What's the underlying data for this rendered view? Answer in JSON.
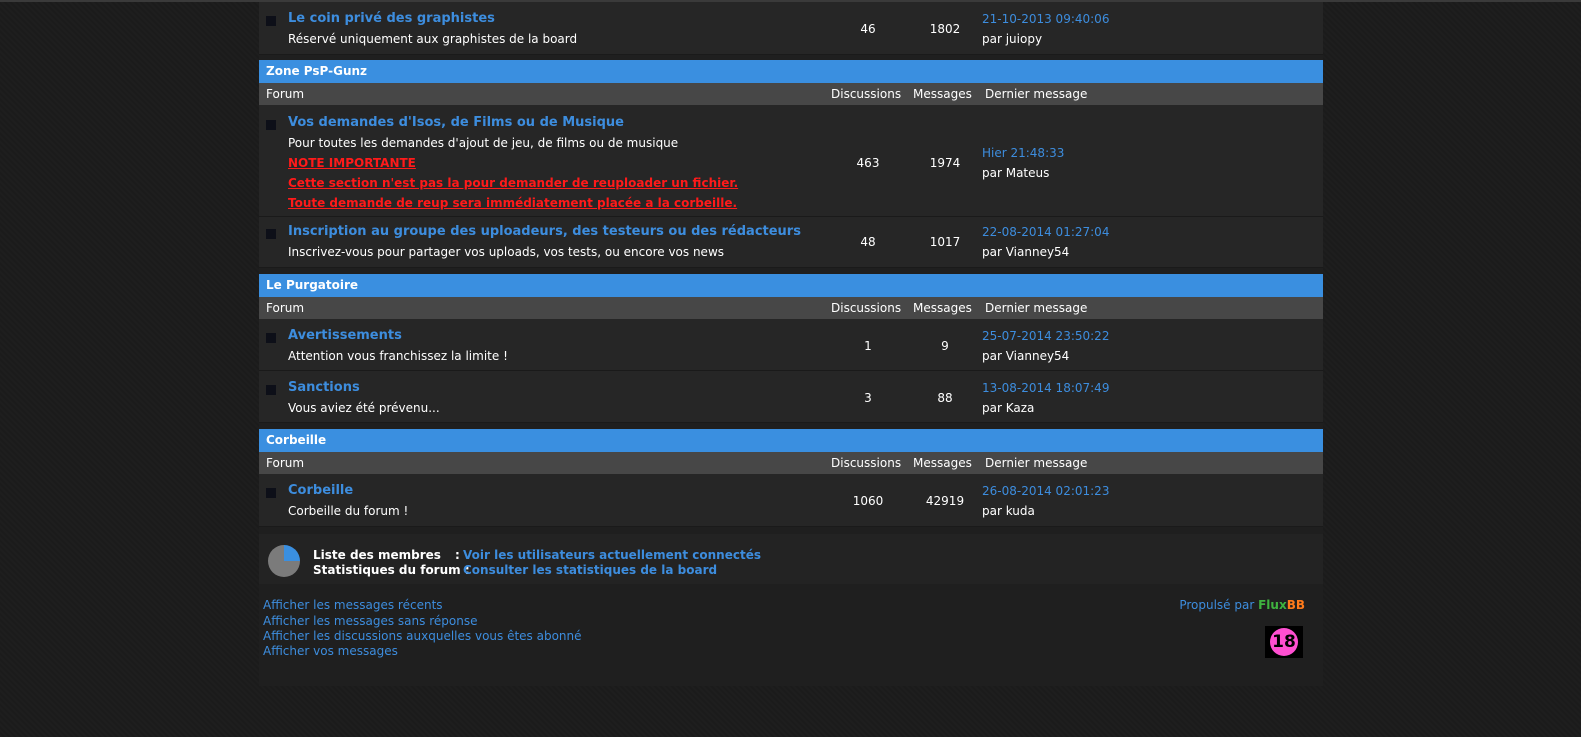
{
  "top_forum": {
    "title": "Le coin privé des graphistes",
    "desc": "Réservé uniquement aux graphistes de la board",
    "discussions": "46",
    "messages": "1802",
    "last_date": "21-10-2013 09:40:06",
    "last_by": "par juiopy"
  },
  "headers": {
    "forum": "Forum",
    "discussions": "Discussions",
    "messages": "Messages",
    "last": "Dernier message"
  },
  "categories": [
    {
      "name": "Zone PsP-Gunz",
      "forums": [
        {
          "title": "Vos demandes d'Isos, de Films ou de Musique",
          "desc": "Pour toutes les demandes d'ajout de jeu, de films ou de musique",
          "notes": [
            "NOTE IMPORTANTE",
            "Cette section n'est pas la pour demander de reuploader un fichier.",
            "Toute demande de reup sera immédiatement placée a la corbeille."
          ],
          "discussions": "463",
          "messages": "1974",
          "last_date": "Hier 21:48:33",
          "last_by": "par Mateus"
        },
        {
          "title": "Inscription au groupe des uploadeurs, des testeurs ou des rédacteurs",
          "desc": "Inscrivez-vous pour partager vos uploads, vos tests, ou encore vos news",
          "discussions": "48",
          "messages": "1017",
          "last_date": "22-08-2014 01:27:04",
          "last_by": "par Vianney54"
        }
      ]
    },
    {
      "name": "Le Purgatoire",
      "forums": [
        {
          "title": "Avertissements",
          "desc": "Attention vous franchissez la limite !",
          "discussions": "1",
          "messages": "9",
          "last_date": "25-07-2014 23:50:22",
          "last_by": "par Vianney54"
        },
        {
          "title": "Sanctions",
          "desc": "Vous aviez été prévenu...",
          "discussions": "3",
          "messages": "88",
          "last_date": "13-08-2014 18:07:49",
          "last_by": "par Kaza"
        }
      ]
    },
    {
      "name": "Corbeille",
      "forums": [
        {
          "title": "Corbeille",
          "desc": "Corbeille du forum !",
          "discussions": "1060",
          "messages": "42919",
          "last_date": "26-08-2014 02:01:23",
          "last_by": "par kuda"
        }
      ]
    }
  ],
  "stats": {
    "members_label": "Liste des membres",
    "members_link": "Voir les utilisateurs actuellement connectés",
    "stats_label": "Statistiques du forum :",
    "stats_link": "Consulter les statistiques de la board",
    "colon": ":"
  },
  "footer": {
    "links": [
      "Afficher les messages récents",
      "Afficher les messages sans réponse",
      "Afficher les discussions auxquelles vous êtes abonné",
      "Afficher vos messages"
    ],
    "powered_prefix": "Propulsé par",
    "powered_flux": "Flux",
    "powered_bb": "BB",
    "badge": "18"
  },
  "colors": {
    "accent": "#3a8fe0",
    "link": "#3d8dde",
    "warning": "#ff1a1a"
  }
}
